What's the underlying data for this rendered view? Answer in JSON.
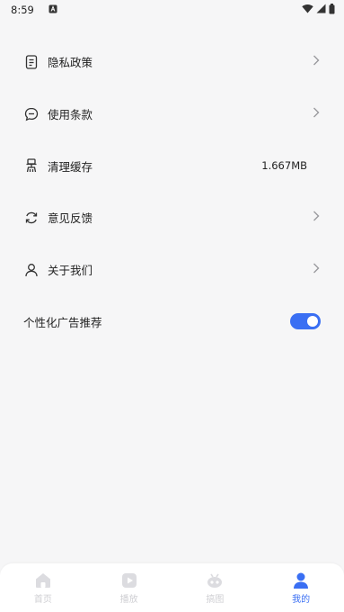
{
  "status_bar": {
    "time": "8:59",
    "notification_icon": "a-box-icon",
    "wifi_icon": "wifi-icon",
    "signal_icon": "signal-icon",
    "battery_icon": "battery-icon"
  },
  "settings": [
    {
      "label": "隐私政策",
      "icon": "document-icon",
      "has_chevron": true
    },
    {
      "label": "使用条款",
      "icon": "chat-bubble-icon",
      "has_chevron": true
    },
    {
      "label": "清理缓存",
      "icon": "broom-icon",
      "value": "1.667MB"
    },
    {
      "label": "意见反馈",
      "icon": "refresh-icon",
      "has_chevron": true
    },
    {
      "label": "关于我们",
      "icon": "person-icon",
      "has_chevron": true
    },
    {
      "label": "个性化广告推荐",
      "toggle_on": true
    }
  ],
  "tabbar": {
    "tabs": [
      {
        "label": "首页",
        "icon": "home-icon",
        "active": false
      },
      {
        "label": "播放",
        "icon": "play-icon",
        "active": false
      },
      {
        "label": "搞图",
        "icon": "robot-icon",
        "active": false
      },
      {
        "label": "我的",
        "icon": "profile-icon",
        "active": true
      }
    ]
  },
  "colors": {
    "accent": "#3a6ff3",
    "background": "#f6f6f7",
    "inactive_tab": "#cfcfd3"
  }
}
